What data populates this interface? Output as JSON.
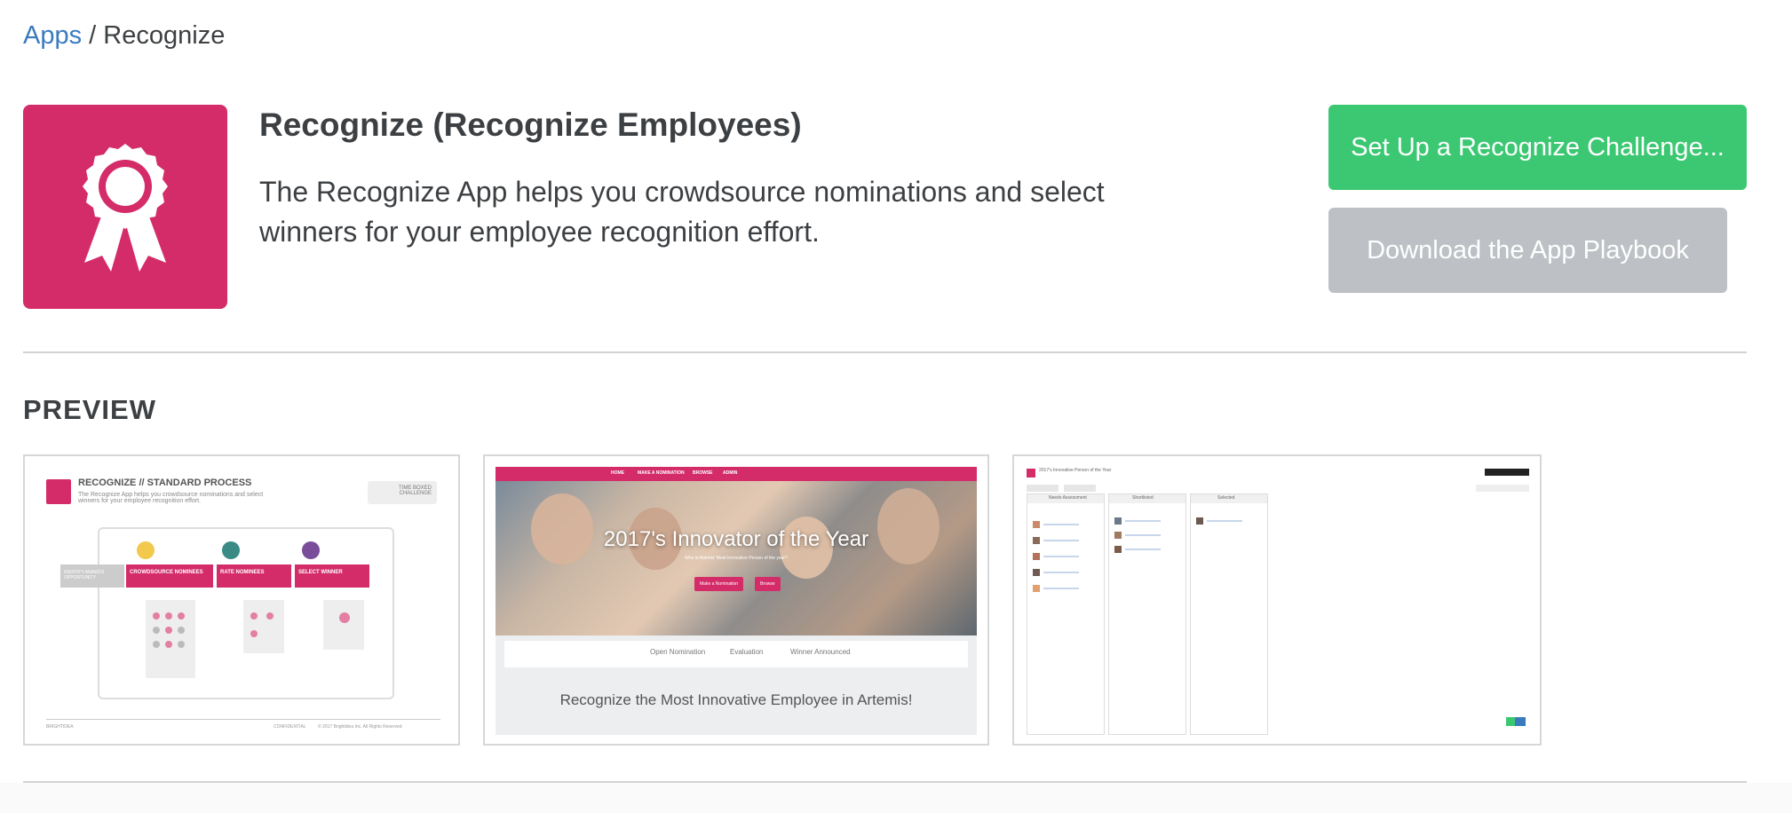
{
  "breadcrumb": {
    "parent": "Apps",
    "separator": "/",
    "current": "Recognize"
  },
  "app": {
    "title": "Recognize (Recognize Employees)",
    "description": "The Recognize App helps you crowdsource nominations and select winners for your employee recognition effort.",
    "icon": "award-ribbon-icon",
    "brand_color": "#d42c68"
  },
  "actions": {
    "primary_label": "Set Up a Recognize Challenge...",
    "primary_color": "#3cc873",
    "secondary_label": "Download the App Playbook",
    "secondary_color": "#bdc1c5"
  },
  "preview": {
    "section_title": "PREVIEW",
    "thumbnails": [
      {
        "title": "RECOGNIZE // STANDARD PROCESS",
        "subtitle": "The Recognize App helps you crowdsource nominations and select winners for your employee recognition effort.",
        "badge": "TIME BOXED CHALLENGE",
        "start_label": "IDENTIFY AWARDS OPPORTUNITY",
        "step1": "CROWDSOURCE NOMINEES",
        "step2": "RATE NOMINEES",
        "step3": "SELECT WINNER",
        "footer_left": "BRIGHTIDEA",
        "footer_mid": "CONFIDENTIAL",
        "footer_right": "© 2017 Brightidea Inc. All Rights Reserved"
      },
      {
        "nav": [
          "HOME",
          "MAKE A NOMINATION",
          "BROWSE",
          "ADMIN"
        ],
        "hero_title": "2017's Innovator of the Year",
        "hero_subtitle": "Who is Artemis' Most Innovative Person of the year?",
        "btn_nominate": "Make a Nomination",
        "btn_browse": "Browse",
        "steps": [
          "Open Nomination",
          "Evaluation",
          "Winner Announced"
        ],
        "body_title": "Recognize the Most Innovative Employee in Artemis!"
      },
      {
        "title": "2017's Innovative Person of the Year",
        "columns": [
          "Needs Assessment",
          "Shortlisted",
          "Selected"
        ]
      }
    ]
  }
}
